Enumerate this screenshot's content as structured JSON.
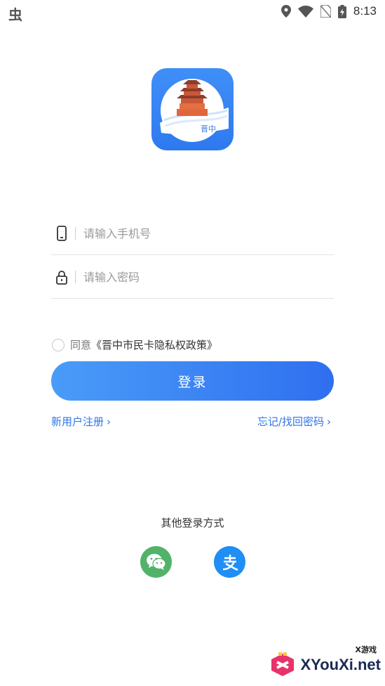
{
  "status_bar": {
    "left_glyph": "虫",
    "time": "8:13",
    "icons": [
      "location-icon",
      "wifi-icon",
      "no-sim-icon",
      "battery-charging-icon"
    ]
  },
  "app": {
    "logo_text": "晋中",
    "logo_icon": "tower-logo-icon"
  },
  "form": {
    "phone_placeholder": "请输入手机号",
    "phone_value": "",
    "password_placeholder": "请输入密码",
    "password_value": "",
    "phone_icon": "phone-icon",
    "lock_icon": "lock-icon"
  },
  "agreement": {
    "prefix": "同意",
    "policy_link": "《晋中市民卡隐私权政策》",
    "checked": false
  },
  "login_button": "登录",
  "links": {
    "register": "新用户注册",
    "forgot": "忘记/找回密码",
    "chevron": "›"
  },
  "other_login": {
    "title": "其他登录方式",
    "methods": [
      {
        "name": "wechat",
        "icon": "wechat-icon",
        "color": "#52b26a"
      },
      {
        "name": "alipay",
        "icon": "alipay-icon",
        "color": "#1f8ef5"
      }
    ]
  },
  "watermark": {
    "text": "XYouXi.net",
    "small": "X游戏"
  },
  "colors": {
    "primary": "#2f74ea",
    "button_start": "#4a9cf8",
    "button_end": "#2f6ff0"
  }
}
